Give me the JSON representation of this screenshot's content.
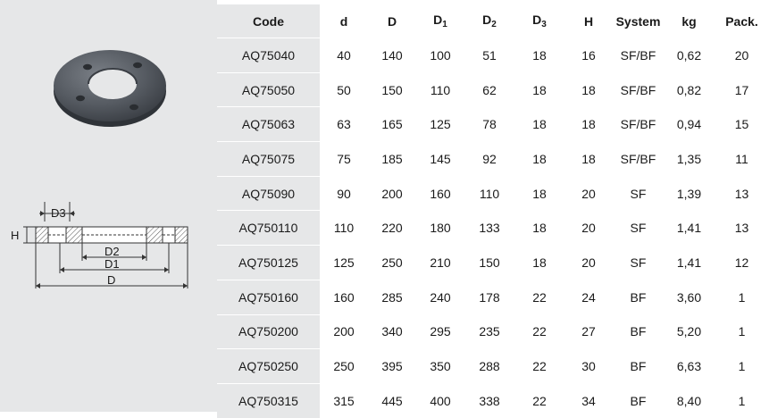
{
  "table": {
    "columns": [
      {
        "label": "Code",
        "sub": ""
      },
      {
        "label": "d",
        "sub": ""
      },
      {
        "label": "D",
        "sub": ""
      },
      {
        "label": "D",
        "sub": "1"
      },
      {
        "label": "D",
        "sub": "2"
      },
      {
        "label": "D",
        "sub": "3"
      },
      {
        "label": "H",
        "sub": ""
      },
      {
        "label": "System",
        "sub": ""
      },
      {
        "label": "kg",
        "sub": ""
      },
      {
        "label": "Pack.",
        "sub": ""
      }
    ],
    "rows": [
      [
        "AQ75040",
        "40",
        "140",
        "100",
        "51",
        "18",
        "16",
        "SF/BF",
        "0,62",
        "20"
      ],
      [
        "AQ75050",
        "50",
        "150",
        "110",
        "62",
        "18",
        "18",
        "SF/BF",
        "0,82",
        "17"
      ],
      [
        "AQ75063",
        "63",
        "165",
        "125",
        "78",
        "18",
        "18",
        "SF/BF",
        "0,94",
        "15"
      ],
      [
        "AQ75075",
        "75",
        "185",
        "145",
        "92",
        "18",
        "18",
        "SF/BF",
        "1,35",
        "11"
      ],
      [
        "AQ75090",
        "90",
        "200",
        "160",
        "110",
        "18",
        "20",
        "SF",
        "1,39",
        "13"
      ],
      [
        "AQ750110",
        "110",
        "220",
        "180",
        "133",
        "18",
        "20",
        "SF",
        "1,41",
        "13"
      ],
      [
        "AQ750125",
        "125",
        "250",
        "210",
        "150",
        "18",
        "20",
        "SF",
        "1,41",
        "12"
      ],
      [
        "AQ750160",
        "160",
        "285",
        "240",
        "178",
        "22",
        "24",
        "BF",
        "3,60",
        "1"
      ],
      [
        "AQ750200",
        "200",
        "340",
        "295",
        "235",
        "22",
        "27",
        "BF",
        "5,20",
        "1"
      ],
      [
        "AQ750250",
        "250",
        "395",
        "350",
        "288",
        "22",
        "30",
        "BF",
        "6,63",
        "1"
      ],
      [
        "AQ750315",
        "315",
        "445",
        "400",
        "338",
        "22",
        "34",
        "BF",
        "8,40",
        "1"
      ]
    ]
  },
  "drawing": {
    "label_d3": "D3",
    "label_h": "H",
    "label_d2": "D2",
    "label_d1": "D1",
    "label_d": "D"
  },
  "colors": {
    "panel": "#e6e7e8",
    "flange_body": "#4a4f55"
  }
}
